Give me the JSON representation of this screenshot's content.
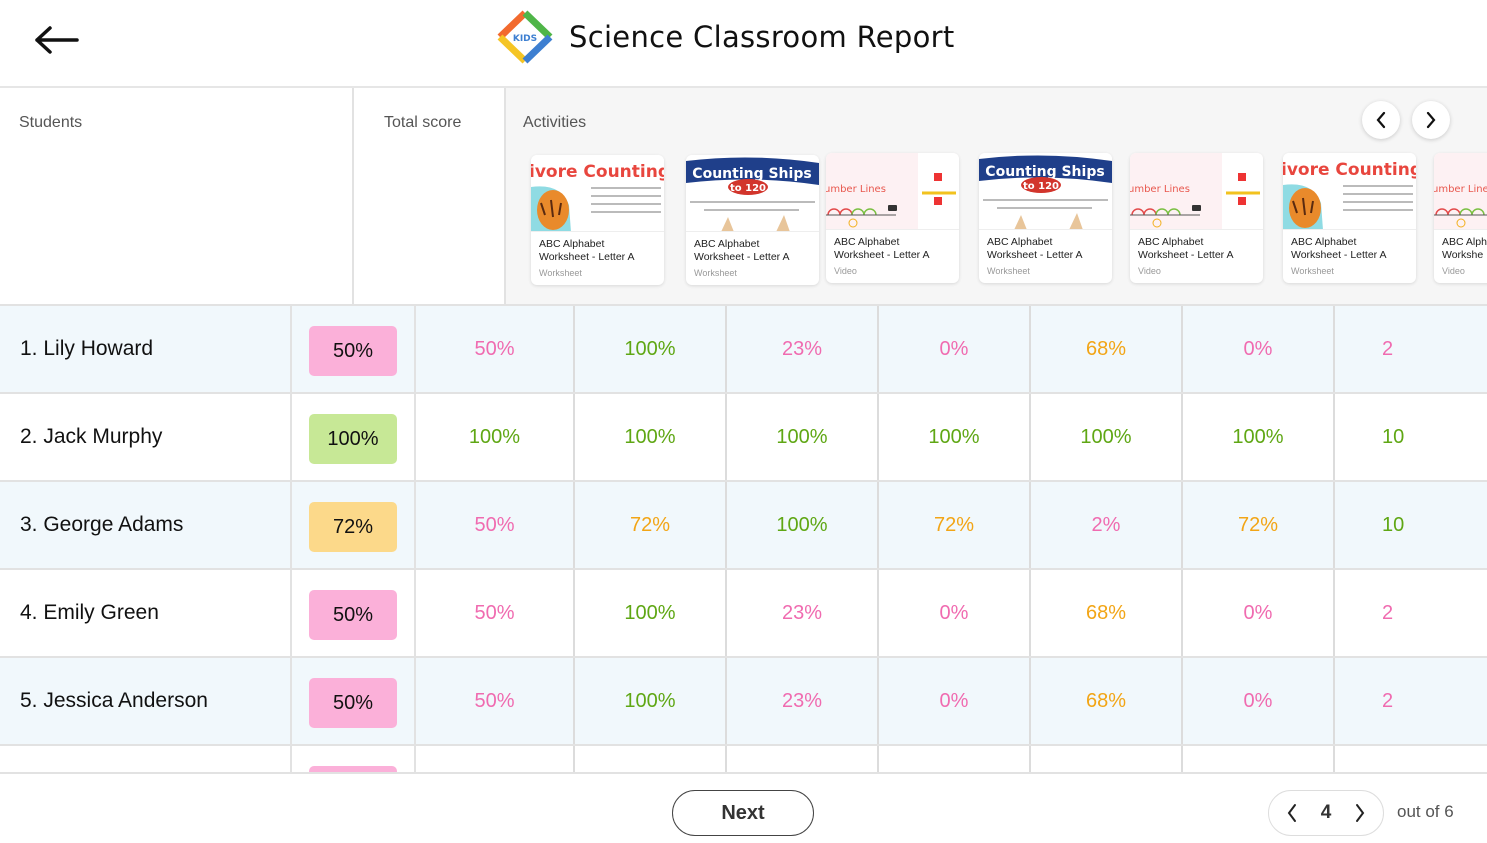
{
  "header": {
    "title": "Science Classroom Report",
    "back_icon": "arrow-left-icon",
    "logo_text": "KIDS"
  },
  "colors": {
    "score_low": "#f06bb0",
    "score_mid": "#f2a516",
    "score_high": "#5fa714",
    "badge_low": "#fbb0d9",
    "badge_mid": "#fcd98a",
    "badge_high": "#c7e896",
    "row_alt": "#f1f8fc"
  },
  "table": {
    "headers": {
      "students": "Students",
      "total": "Total score",
      "activities": "Activities"
    },
    "activities": [
      {
        "title_line1": "ABC Alphabet",
        "title_line2": "Worksheet - Letter A",
        "type": "Worksheet",
        "thumb": "carnivore-counting",
        "thumb_text": "ivore Counting to"
      },
      {
        "title_line1": "ABC Alphabet",
        "title_line2": "Worksheet - Letter A",
        "type": "Worksheet",
        "thumb": "counting-ships",
        "thumb_text": "Counting Ships",
        "thumb_sub": "to 120"
      },
      {
        "title_line1": "ABC Alphabet",
        "title_line2": "Worksheet - Letter A",
        "type": "Video",
        "thumb": "number-lines",
        "thumb_text": "umber Lines"
      },
      {
        "title_line1": "ABC Alphabet",
        "title_line2": "Worksheet - Letter A",
        "type": "Worksheet",
        "thumb": "counting-ships",
        "thumb_text": "Counting Ships",
        "thumb_sub": "to 120"
      },
      {
        "title_line1": "ABC Alphabet",
        "title_line2": "Worksheet - Letter A",
        "type": "Video",
        "thumb": "number-lines",
        "thumb_text": "umber Lines"
      },
      {
        "title_line1": "ABC Alphabet",
        "title_line2": "Worksheet - Letter A",
        "type": "Worksheet",
        "thumb": "carnivore-counting",
        "thumb_text": "ivore Counting to"
      },
      {
        "title_line1": "ABC Alph",
        "title_line2": "Workshe",
        "type": "Video",
        "thumb": "number-lines",
        "thumb_text": "umber Lines"
      }
    ],
    "students": [
      {
        "name": "1. Lily Howard",
        "total": "50%",
        "total_level": "low",
        "scores": [
          {
            "v": "50%",
            "l": "low"
          },
          {
            "v": "100%",
            "l": "high"
          },
          {
            "v": "23%",
            "l": "low"
          },
          {
            "v": "0%",
            "l": "low"
          },
          {
            "v": "68%",
            "l": "mid"
          },
          {
            "v": "0%",
            "l": "low"
          },
          {
            "v": "2",
            "l": "low"
          }
        ]
      },
      {
        "name": "2. Jack Murphy",
        "total": "100%",
        "total_level": "high",
        "scores": [
          {
            "v": "100%",
            "l": "high"
          },
          {
            "v": "100%",
            "l": "high"
          },
          {
            "v": "100%",
            "l": "high"
          },
          {
            "v": "100%",
            "l": "high"
          },
          {
            "v": "100%",
            "l": "high"
          },
          {
            "v": "100%",
            "l": "high"
          },
          {
            "v": "10",
            "l": "high"
          }
        ]
      },
      {
        "name": "3. George Adams",
        "total": "72%",
        "total_level": "mid",
        "scores": [
          {
            "v": "50%",
            "l": "low"
          },
          {
            "v": "72%",
            "l": "mid"
          },
          {
            "v": "100%",
            "l": "high"
          },
          {
            "v": "72%",
            "l": "mid"
          },
          {
            "v": "2%",
            "l": "low"
          },
          {
            "v": "72%",
            "l": "mid"
          },
          {
            "v": "10",
            "l": "high"
          }
        ]
      },
      {
        "name": "4. Emily Green",
        "total": "50%",
        "total_level": "low",
        "scores": [
          {
            "v": "50%",
            "l": "low"
          },
          {
            "v": "100%",
            "l": "high"
          },
          {
            "v": "23%",
            "l": "low"
          },
          {
            "v": "0%",
            "l": "low"
          },
          {
            "v": "68%",
            "l": "mid"
          },
          {
            "v": "0%",
            "l": "low"
          },
          {
            "v": "2",
            "l": "low"
          }
        ]
      },
      {
        "name": "5. Jessica Anderson",
        "total": "50%",
        "total_level": "low",
        "scores": [
          {
            "v": "50%",
            "l": "low"
          },
          {
            "v": "100%",
            "l": "high"
          },
          {
            "v": "23%",
            "l": "low"
          },
          {
            "v": "0%",
            "l": "low"
          },
          {
            "v": "68%",
            "l": "mid"
          },
          {
            "v": "0%",
            "l": "low"
          },
          {
            "v": "2",
            "l": "low"
          }
        ]
      }
    ],
    "partial_row_total_level": "low"
  },
  "footer": {
    "next_label": "Next",
    "current_page": "4",
    "total_pages_label": "out of 6"
  }
}
